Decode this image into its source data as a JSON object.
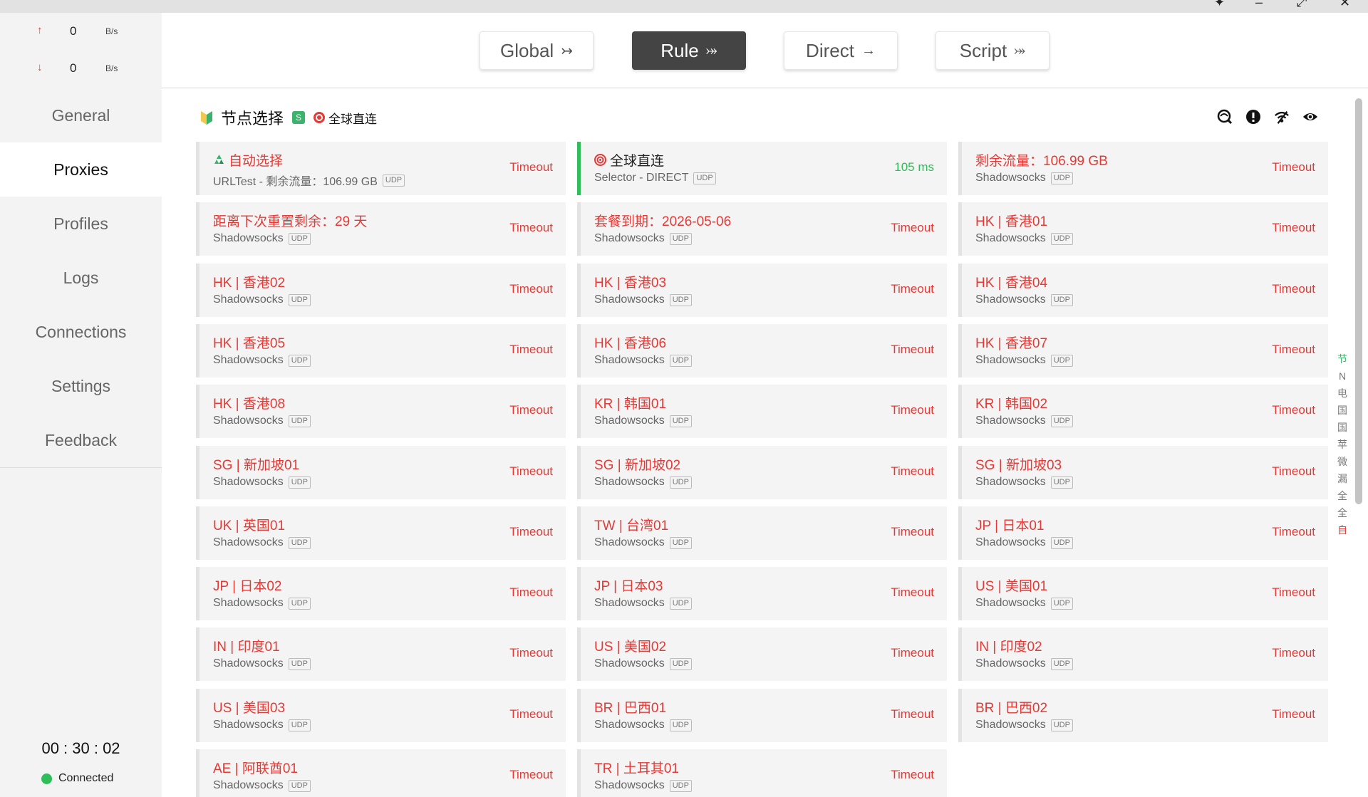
{
  "window": {
    "buttons": [
      "pin-icon",
      "minimize-icon",
      "restore-icon",
      "close-icon"
    ]
  },
  "traffic": {
    "up": {
      "value": "0",
      "unit": "B/s"
    },
    "down": {
      "value": "0",
      "unit": "B/s"
    }
  },
  "nav": {
    "items": [
      "General",
      "Proxies",
      "Profiles",
      "Logs",
      "Connections",
      "Settings",
      "Feedback"
    ],
    "active": "Proxies"
  },
  "footer": {
    "timer": "00 : 30 : 02",
    "status": "Connected"
  },
  "modes": [
    {
      "label": "Global",
      "icon": "arrow-merge-icon"
    },
    {
      "label": "Rule",
      "icon": "arrow-split-icon",
      "active": true
    },
    {
      "label": "Direct",
      "icon": "arrow-right-icon"
    },
    {
      "label": "Script",
      "icon": "arrow-split-icon"
    }
  ],
  "group": {
    "name": "节点选择",
    "badge": "S",
    "current": "全球直连",
    "actions": [
      "speedtest-icon",
      "alert-icon",
      "wifi-icon",
      "eye-icon"
    ]
  },
  "proxies": [
    {
      "name": "自动选择",
      "type": "URLTest - 剩余流量：106.99 GB",
      "udp": "UDP",
      "latency": "Timeout",
      "icon": "recycle-icon"
    },
    {
      "name": "全球直连",
      "type": "Selector - DIRECT",
      "udp": "UDP",
      "latency": "105 ms",
      "selected": true,
      "icon": "target-icon"
    },
    {
      "name": "剩余流量：106.99 GB",
      "type": "Shadowsocks",
      "udp": "UDP",
      "latency": "Timeout"
    },
    {
      "name": "距离下次重置剩余：29 天",
      "type": "Shadowsocks",
      "udp": "UDP",
      "latency": "Timeout"
    },
    {
      "name": "套餐到期：2026-05-06",
      "type": "Shadowsocks",
      "udp": "UDP",
      "latency": "Timeout"
    },
    {
      "name": "HK | 香港01",
      "type": "Shadowsocks",
      "udp": "UDP",
      "latency": "Timeout"
    },
    {
      "name": "HK | 香港02",
      "type": "Shadowsocks",
      "udp": "UDP",
      "latency": "Timeout"
    },
    {
      "name": "HK | 香港03",
      "type": "Shadowsocks",
      "udp": "UDP",
      "latency": "Timeout"
    },
    {
      "name": "HK | 香港04",
      "type": "Shadowsocks",
      "udp": "UDP",
      "latency": "Timeout"
    },
    {
      "name": "HK | 香港05",
      "type": "Shadowsocks",
      "udp": "UDP",
      "latency": "Timeout"
    },
    {
      "name": "HK | 香港06",
      "type": "Shadowsocks",
      "udp": "UDP",
      "latency": "Timeout"
    },
    {
      "name": "HK | 香港07",
      "type": "Shadowsocks",
      "udp": "UDP",
      "latency": "Timeout"
    },
    {
      "name": "HK | 香港08",
      "type": "Shadowsocks",
      "udp": "UDP",
      "latency": "Timeout"
    },
    {
      "name": "KR | 韩国01",
      "type": "Shadowsocks",
      "udp": "UDP",
      "latency": "Timeout"
    },
    {
      "name": "KR | 韩国02",
      "type": "Shadowsocks",
      "udp": "UDP",
      "latency": "Timeout"
    },
    {
      "name": "SG | 新加坡01",
      "type": "Shadowsocks",
      "udp": "UDP",
      "latency": "Timeout"
    },
    {
      "name": "SG | 新加坡02",
      "type": "Shadowsocks",
      "udp": "UDP",
      "latency": "Timeout"
    },
    {
      "name": "SG | 新加坡03",
      "type": "Shadowsocks",
      "udp": "UDP",
      "latency": "Timeout"
    },
    {
      "name": "UK | 英国01",
      "type": "Shadowsocks",
      "udp": "UDP",
      "latency": "Timeout"
    },
    {
      "name": "TW | 台湾01",
      "type": "Shadowsocks",
      "udp": "UDP",
      "latency": "Timeout"
    },
    {
      "name": "JP | 日本01",
      "type": "Shadowsocks",
      "udp": "UDP",
      "latency": "Timeout"
    },
    {
      "name": "JP | 日本02",
      "type": "Shadowsocks",
      "udp": "UDP",
      "latency": "Timeout"
    },
    {
      "name": "JP | 日本03",
      "type": "Shadowsocks",
      "udp": "UDP",
      "latency": "Timeout"
    },
    {
      "name": "US | 美国01",
      "type": "Shadowsocks",
      "udp": "UDP",
      "latency": "Timeout"
    },
    {
      "name": "IN | 印度01",
      "type": "Shadowsocks",
      "udp": "UDP",
      "latency": "Timeout"
    },
    {
      "name": "US | 美国02",
      "type": "Shadowsocks",
      "udp": "UDP",
      "latency": "Timeout"
    },
    {
      "name": "IN | 印度02",
      "type": "Shadowsocks",
      "udp": "UDP",
      "latency": "Timeout"
    },
    {
      "name": "US | 美国03",
      "type": "Shadowsocks",
      "udp": "UDP",
      "latency": "Timeout"
    },
    {
      "name": "BR | 巴西01",
      "type": "Shadowsocks",
      "udp": "UDP",
      "latency": "Timeout"
    },
    {
      "name": "BR | 巴西02",
      "type": "Shadowsocks",
      "udp": "UDP",
      "latency": "Timeout"
    },
    {
      "name": "AE | 阿联酋01",
      "type": "Shadowsocks",
      "udp": "UDP",
      "latency": "Timeout"
    },
    {
      "name": "TR | 土耳其01",
      "type": "Shadowsocks",
      "udp": "UDP",
      "latency": "Timeout"
    }
  ],
  "alpha_index": [
    "节",
    "N",
    "电",
    "国",
    "国",
    "苹",
    "微",
    "漏",
    "全",
    "全",
    "自"
  ],
  "colors": {
    "timeout": "#e53935",
    "ok": "#2ebd59",
    "active_mode": "#444444"
  }
}
